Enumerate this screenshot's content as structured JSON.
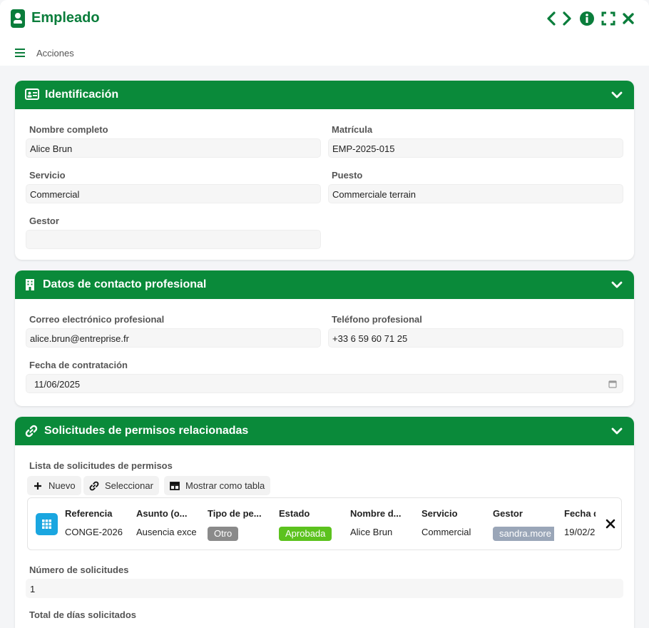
{
  "window": {
    "title": "Empleado",
    "actions_label": "Acciones",
    "icons": [
      "chevron-left-icon",
      "chevron-right-icon",
      "info-icon",
      "fullscreen-icon",
      "close-icon",
      "menu-icon",
      "employee-badge-icon"
    ]
  },
  "colors": {
    "brand": "#0a7d3b",
    "header": "#0a8a3a",
    "badge_approved": "#5cc21e",
    "badge_other": "#8a8a8a",
    "tag_manager": "#9aa6b8",
    "grid_icon": "#1aa6e0"
  },
  "identificacion": {
    "title": "Identificación",
    "nombre_label": "Nombre completo",
    "nombre_value": "Alice Brun",
    "matricula_label": "Matrícula",
    "matricula_value": "EMP-2025-015",
    "servicio_label": "Servicio",
    "servicio_value": "Commercial",
    "puesto_label": "Puesto",
    "puesto_value": "Commerciale terrain",
    "gestor_label": "Gestor",
    "gestor_value": ""
  },
  "contacto": {
    "title": "Datos de contacto profesional",
    "correo_label": "Correo electrónico profesional",
    "correo_value": "alice.brun@entreprise.fr",
    "telefono_label": "Teléfono profesional",
    "telefono_value": "+33 6 59 60 71 25",
    "fecha_label": "Fecha de contratación",
    "fecha_value": "11/06/2025"
  },
  "solicitudes": {
    "title": "Solicitudes de permisos relacionadas",
    "list_label": "Lista de solicitudes de permisos",
    "buttons": {
      "nuevo": "Nuevo",
      "seleccionar": "Seleccionar",
      "tabla": "Mostrar como tabla"
    },
    "columns": [
      "Referencia",
      "Asunto (o...",
      "Tipo de pe...",
      "Estado",
      "Nombre d...",
      "Servicio",
      "Gestor",
      "Fecha d"
    ],
    "row": {
      "referencia": "CONGE-2026",
      "asunto": "Ausencia exce",
      "tipo": "Otro",
      "estado": "Aprobada",
      "nombre": "Alice Brun",
      "servicio": "Commercial",
      "gestor": "sandra.more",
      "fecha": "19/02/2"
    },
    "numero_label": "Número de solicitudes",
    "numero_value": "1",
    "total_label": "Total de días solicitados"
  }
}
